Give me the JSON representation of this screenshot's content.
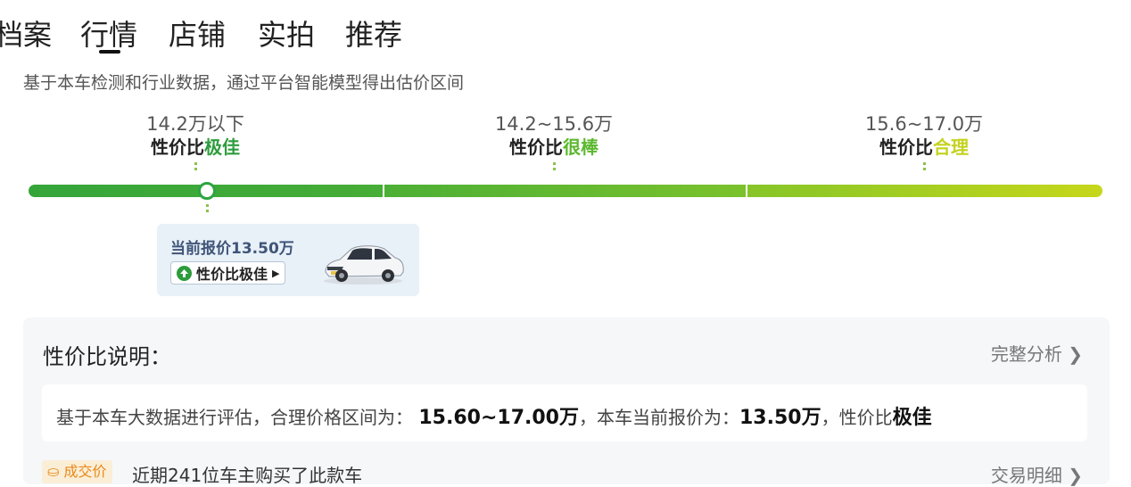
{
  "tabs": [
    {
      "label": "档案"
    },
    {
      "label": "行情"
    },
    {
      "label": "店铺"
    },
    {
      "label": "实拍"
    },
    {
      "label": "推荐"
    }
  ],
  "active_tab": "行情",
  "description": "基于本车检测和行业数据，通过平台智能模型得出估价区间",
  "ranges": [
    {
      "value": "14.2万以下",
      "label_prefix": "性价比",
      "label_grade": "极佳"
    },
    {
      "value": "14.2~15.6万",
      "label_prefix": "性价比",
      "label_grade": "很棒"
    },
    {
      "value": "15.6~17.0万",
      "label_prefix": "性价比",
      "label_grade": "合理"
    }
  ],
  "current_price": {
    "text": "当前报价13.50万",
    "badge": "性价比极佳"
  },
  "explanation": {
    "title": "性价比说明：",
    "link": "完整分析",
    "text_prefix": "基于本车大数据进行评估，合理价格区间为：",
    "range": "15.60~17.00万",
    "text_mid": "，本车当前报价为：",
    "price": "13.50万",
    "text_suffix": "，性价比",
    "grade": "极佳"
  },
  "deal": {
    "tag": "成交价",
    "text": "近期241位车主购买了此款车",
    "link": "交易明细"
  },
  "colors": {
    "best": "#2e9c3d",
    "great": "#5bb82e",
    "fair": "#c4d21e"
  }
}
